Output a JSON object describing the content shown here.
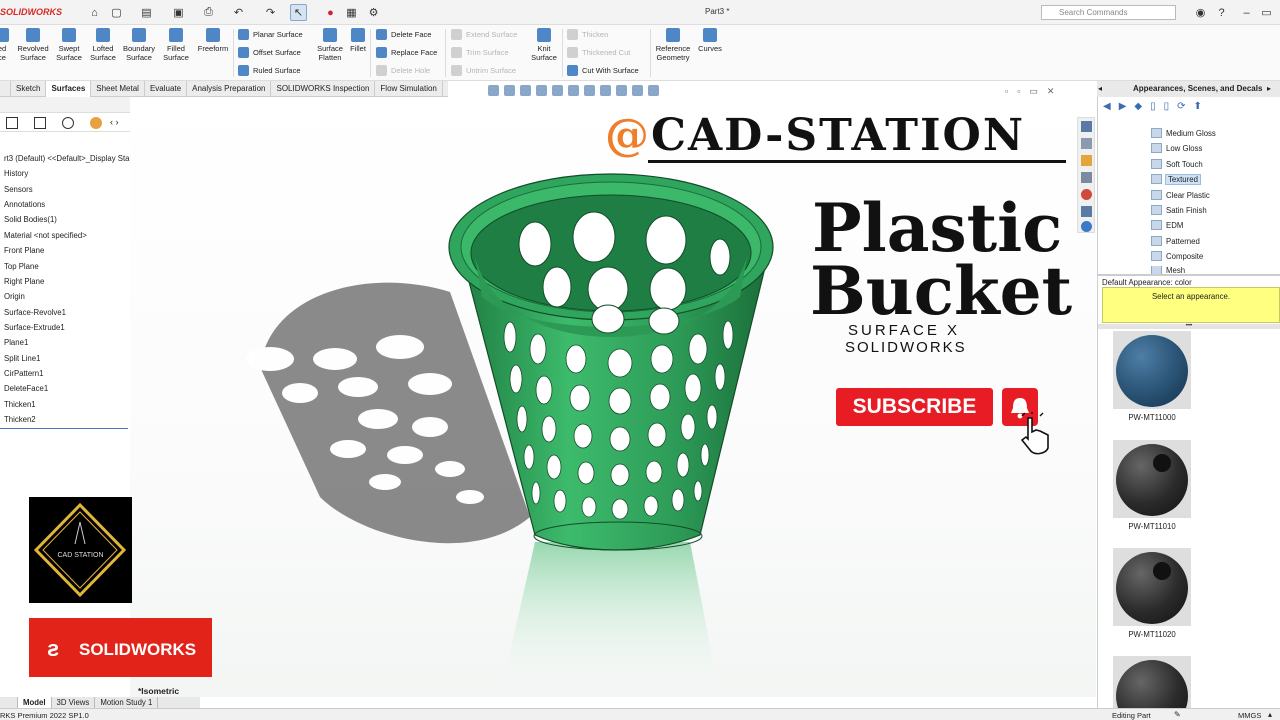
{
  "app": {
    "logo": "SOLIDWORKS",
    "doc_title": "Part3 *",
    "search_placeholder": "Search Commands"
  },
  "ribbon": {
    "big_buttons": [
      "Revolved Surface",
      "Swept Surface",
      "Lofted Surface",
      "Boundary Surface",
      "Filled Surface",
      "Freeform"
    ],
    "surface_col": [
      "Planar Surface",
      "Offset Surface",
      "Ruled Surface"
    ],
    "flatten": "Surface Flatten",
    "fillet": "Fillet",
    "face_col": [
      "Delete Face",
      "Replace Face",
      "Delete Hole"
    ],
    "extend_col": [
      "Extend Surface",
      "Trim Surface",
      "Untrim Surface"
    ],
    "knit": "Knit Surface",
    "thicken_col": [
      "Thicken",
      "Thickened Cut",
      "Cut With Surface"
    ],
    "reference": "Reference Geometry",
    "curves": "Curves"
  },
  "tabs": [
    "Sketch",
    "Surfaces",
    "Sheet Metal",
    "Evaluate",
    "Analysis Preparation",
    "SOLIDWORKS Inspection",
    "Flow Simulation"
  ],
  "active_tab": "Surfaces",
  "feature_tree": [
    "rt3 (Default) <<Default>_Display Sta",
    "History",
    "Sensors",
    "Annotations",
    "Solid Bodies(1)",
    "Material <not specified>",
    "Front Plane",
    "Top Plane",
    "Right Plane",
    "Origin",
    "Surface-Revolve1",
    "Surface-Extrude1",
    "Plane1",
    "Split Line1",
    "CirPattern1",
    "DeleteFace1",
    "Thicken1",
    "Thicken2"
  ],
  "task_pane": {
    "title": "Appearances, Scenes, and Decals",
    "items": [
      "Medium Gloss",
      "Low Gloss",
      "Soft Touch",
      "Textured",
      "Clear Plastic",
      "Satin Finish",
      "EDM",
      "Patterned",
      "Composite",
      "Mesh"
    ],
    "selected": "Textured",
    "default_appearance": "Default Appearance: color",
    "select_prompt": "Select an appearance.",
    "swatches": [
      {
        "label": "PW-MT11000",
        "color": "#2c5678"
      },
      {
        "label": "PW-MT11010",
        "color": "#2b2b2b"
      },
      {
        "label": "PW-MT11020",
        "color": "#2b2b2b"
      },
      {
        "label": "",
        "color": "#2b2b2b"
      }
    ]
  },
  "viewport": {
    "view_name": "*Isometric"
  },
  "overlay": {
    "brand_at": "@",
    "brand": "CAD-STATION",
    "title_line1": "Plastic",
    "title_line2": "Bucket",
    "subtitle1": "SURFACE X",
    "subtitle2": "SOLIDWORKS",
    "subscribe": "SUBSCRIBE",
    "cad_logo_text": "CAD STATION",
    "sw_logo_text": "SOLIDWORKS"
  },
  "bottom_tabs": [
    "Model",
    "3D Views",
    "Motion Study 1"
  ],
  "status": {
    "left": "RKS Premium 2022 SP1.0",
    "editing": "Editing Part",
    "units": "MMGS"
  },
  "colors": {
    "bucket": "#2fa55d",
    "bucket_dark": "#1d7a40",
    "accent": "#e81c24",
    "brand_at": "#ef7d2a"
  }
}
